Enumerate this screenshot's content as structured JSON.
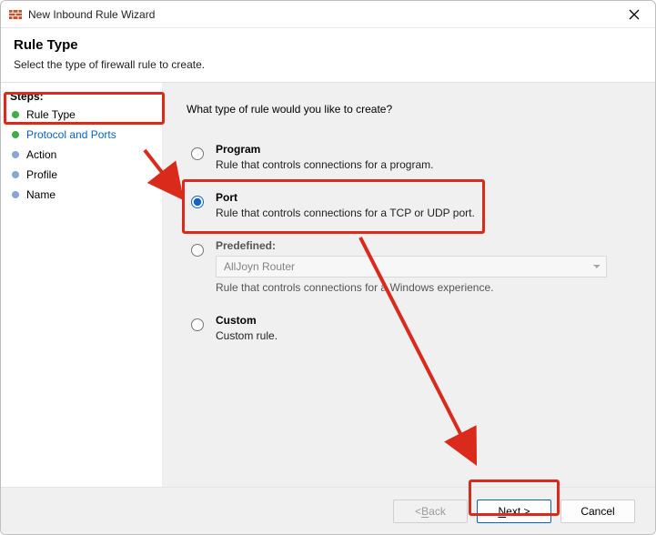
{
  "window": {
    "title": "New Inbound Rule Wizard"
  },
  "header": {
    "title": "Rule Type",
    "subtitle": "Select the type of firewall rule to create."
  },
  "sidebar": {
    "steps_label": "Steps:",
    "items": [
      {
        "label": "Rule Type"
      },
      {
        "label": "Protocol and Ports"
      },
      {
        "label": "Action"
      },
      {
        "label": "Profile"
      },
      {
        "label": "Name"
      }
    ]
  },
  "content": {
    "question": "What type of rule would you like to create?",
    "options": {
      "program": {
        "label": "Program",
        "desc": "Rule that controls connections for a program."
      },
      "port": {
        "label": "Port",
        "desc": "Rule that controls connections for a TCP or UDP port."
      },
      "predefined": {
        "label": "Predefined:",
        "selected": "AllJoyn Router",
        "desc": "Rule that controls connections for a Windows experience."
      },
      "custom": {
        "label": "Custom",
        "desc": "Custom rule."
      }
    }
  },
  "footer": {
    "back_prefix": "< ",
    "back_u": "B",
    "back_rest": "ack",
    "next_u": "N",
    "next_rest": "ext >",
    "cancel": "Cancel"
  }
}
